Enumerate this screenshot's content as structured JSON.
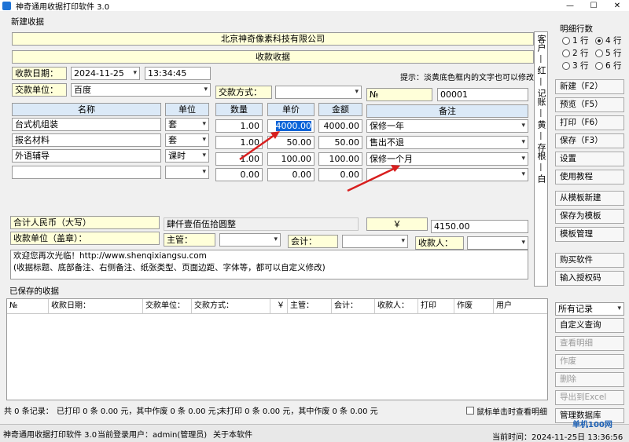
{
  "window": {
    "title": "神奇通用收据打印软件 3.0",
    "min": "—",
    "max": "☐",
    "close": "✕"
  },
  "form": {
    "group_label": "新建收据",
    "company": "北京神奇像素科技有限公司",
    "receipt_title": "收款收据",
    "date_label": "收款日期：",
    "date_value": "2024-11-25",
    "time_value": "13:34:45",
    "tip": "提示：淡黄底色框内的文字也可以修改",
    "payer_label": "交款单位：",
    "payer_value": "百度",
    "method_label": "交款方式：",
    "method_value": "",
    "no_label": "№",
    "no_value": "00001",
    "columns": [
      "名称",
      "单位",
      "数量",
      "单价",
      "金额",
      "备注"
    ],
    "rows": [
      {
        "name": "台式机组装",
        "unit": "套",
        "qty": "1.00",
        "price": "4000.00",
        "amount": "4000.00",
        "note": "保修一年"
      },
      {
        "name": "报名材料",
        "unit": "套",
        "qty": "1.00",
        "price": "50.00",
        "amount": "50.00",
        "note": "售出不退"
      },
      {
        "name": "外语辅导",
        "unit": "课时",
        "qty": "1.00",
        "price": "100.00",
        "amount": "100.00",
        "note": "保修一个月"
      },
      {
        "name": "",
        "unit": "",
        "qty": "0.00",
        "price": "0.00",
        "amount": "0.00",
        "note": ""
      }
    ],
    "total_label": "合计人民币（大写）",
    "total_words": "肆仟壹佰伍拾圆整",
    "currency": "￥",
    "total_value": "4150.00",
    "stamp_label": "收款单位（盖章）：",
    "manager_label": "主管：",
    "accountant_label": "会计：",
    "receiver_label": "收款人：",
    "footer_text": "欢迎您再次光临！http://www.shenqixiangsu.com\n(收据标题、底部备注、右侧备注、纸张类型、页面边距、字体等，都可以自定义修改)",
    "side_note": "客户 — 红 — 记账 — 黄 — 存根 — 白"
  },
  "rowcount": {
    "label": "明细行数",
    "options": [
      "1 行",
      "4 行",
      "2 行",
      "5 行",
      "3 行",
      "6 行"
    ],
    "selected": "4 行"
  },
  "buttons": {
    "new": "新建（F2）",
    "preview": "预览（F5）",
    "print": "打印（F6）",
    "save": "保存（F3）",
    "settings": "设置",
    "tutorial": "使用教程",
    "from_template": "从模板新建",
    "save_template": "保存为模板",
    "manage_template": "模板管理",
    "buy": "购买软件",
    "license": "输入授权码"
  },
  "saved": {
    "label": "已保存的收据",
    "columns": [
      "№",
      "收款日期：",
      "交款单位：",
      "交款方式：",
      "￥",
      "主管：",
      "会计：",
      "收款人：",
      "打印",
      "作废",
      "用户"
    ],
    "filter": "所有记录",
    "query": "自定义查询",
    "view": "查看明细",
    "void": "作废",
    "delete": "删除",
    "export": "导出到Excel",
    "db": "管理数据库",
    "summary1": "共 0 条记录：",
    "summary2": "已打印 0 条 0.00 元，其中作废 0 条 0.00 元；",
    "summary3": "未打印 0 条 0.00 元，其中作废 0 条 0.00 元",
    "dblclick": "鼠标单击时查看明细"
  },
  "status": {
    "app": "神奇通用收据打印软件 3.0",
    "user": "当前登录用户：admin(管理员)",
    "about": "关于本软件",
    "time": "当前时间：2024-11-25日 13:36:56"
  },
  "watermark": "单机100网"
}
